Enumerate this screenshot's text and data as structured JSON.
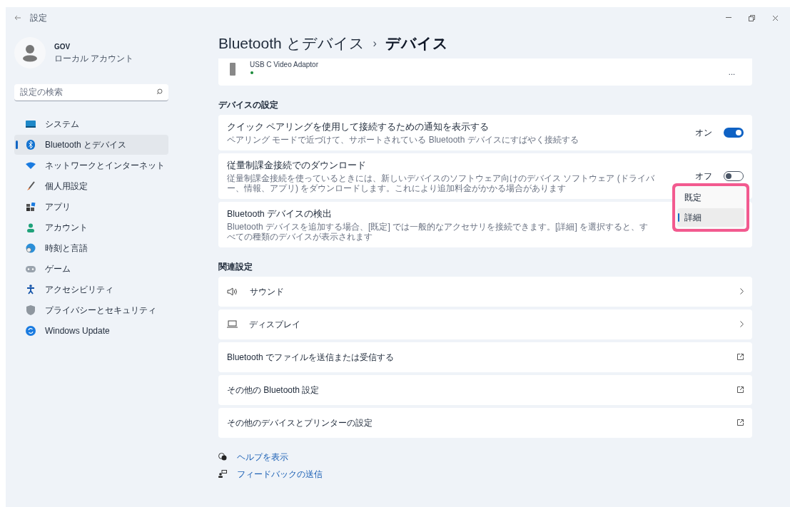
{
  "window": {
    "title": "設定"
  },
  "profile": {
    "name": "GOV",
    "account": "ローカル アカウント"
  },
  "search": {
    "placeholder": "設定の検索"
  },
  "nav": [
    {
      "kind": "system",
      "label": "システム",
      "selected": false
    },
    {
      "kind": "bluetooth",
      "label": "Bluetooth とデバイス",
      "selected": true
    },
    {
      "kind": "network",
      "label": "ネットワークとインターネット",
      "selected": false
    },
    {
      "kind": "personalize",
      "label": "個人用設定",
      "selected": false
    },
    {
      "kind": "apps",
      "label": "アプリ",
      "selected": false
    },
    {
      "kind": "account",
      "label": "アカウント",
      "selected": false
    },
    {
      "kind": "time",
      "label": "時刻と言語",
      "selected": false
    },
    {
      "kind": "game",
      "label": "ゲーム",
      "selected": false
    },
    {
      "kind": "accessibility",
      "label": "アクセシビリティ",
      "selected": false
    },
    {
      "kind": "privacy",
      "label": "プライバシーとセキュリティ",
      "selected": false
    },
    {
      "kind": "update",
      "label": "Windows Update",
      "selected": false
    }
  ],
  "breadcrumb": {
    "parent": "Bluetooth とデバイス",
    "separator": "›",
    "current": "デバイス"
  },
  "device": {
    "name": "USB C Video Adaptor",
    "more": "..."
  },
  "device_settings": {
    "heading": "デバイスの設定",
    "rows": [
      {
        "kind": "toggle",
        "title": "クイック ペアリングを使用して接続するための通知を表示する",
        "description": "ペアリング モードで近づけて、サポートされている Bluetooth デバイスにすばやく接続する",
        "state_label": "オン",
        "on": true
      },
      {
        "kind": "toggle",
        "title": "従量制課金接続でのダウンロード",
        "description": "従量制課金接続を使っているときには、新しいデバイスのソフトウェア向けのデバイス ソフトウェア (ドライバー、情報、アプリ) をダウンロードします。これにより追加料金がかかる場合があります",
        "state_label": "オフ",
        "on": false
      },
      {
        "kind": "dropdown",
        "title": "Bluetooth デバイスの検出",
        "description": "Bluetooth デバイスを追加する場合、[既定] では一般的なアクセサリを接続できます。[詳細] を選択すると、すべての種類のデバイスが表示されます",
        "options": [
          {
            "label": "既定",
            "selected": false
          },
          {
            "label": "詳細",
            "selected": true
          }
        ]
      }
    ]
  },
  "related": {
    "heading": "関連設定",
    "rows": [
      {
        "kind": "sound",
        "label": "サウンド"
      },
      {
        "kind": "display",
        "label": "ディスプレイ"
      },
      {
        "kind": "external",
        "label": "Bluetooth でファイルを送信または受信する"
      },
      {
        "kind": "external",
        "label": "その他の Bluetooth 設定"
      },
      {
        "kind": "external",
        "label": "その他のデバイスとプリンターの設定"
      }
    ]
  },
  "links": [
    {
      "kind": "help",
      "label": "ヘルプを表示"
    },
    {
      "kind": "feedback",
      "label": "フィードバックの送信"
    }
  ]
}
